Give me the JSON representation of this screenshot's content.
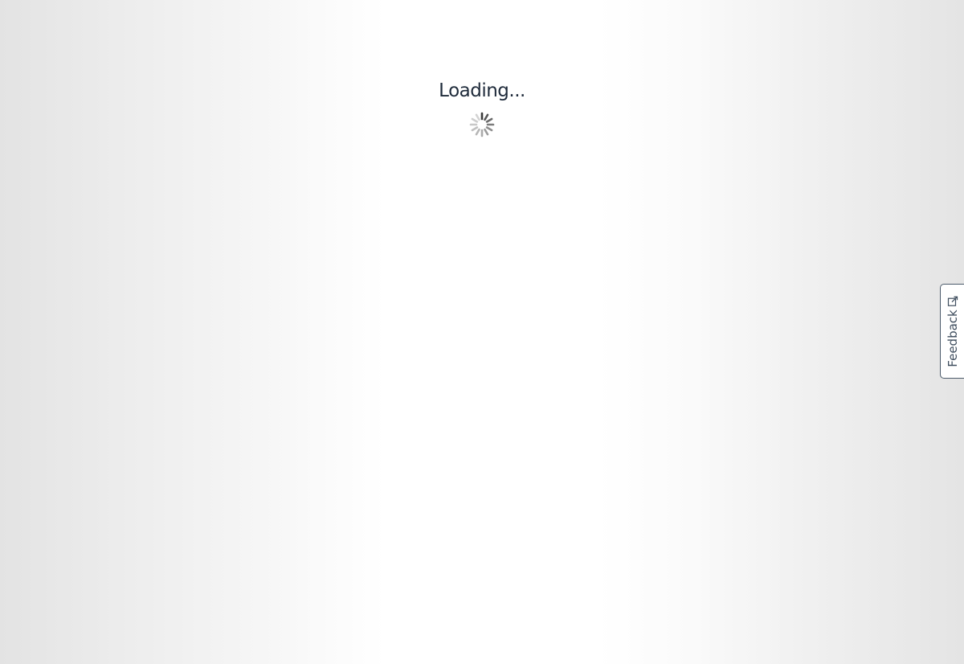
{
  "loading": {
    "text": "Loading...",
    "spinner_icon": "loading-spinner-icon"
  },
  "feedback_tab": {
    "label": "Feedback",
    "icon": "external-link-icon"
  },
  "colors": {
    "text": "#1e2a3a",
    "feedback_border": "#4b5a6a",
    "spinner_dark": "#444444",
    "spinner_light": "#d0d0d0"
  }
}
